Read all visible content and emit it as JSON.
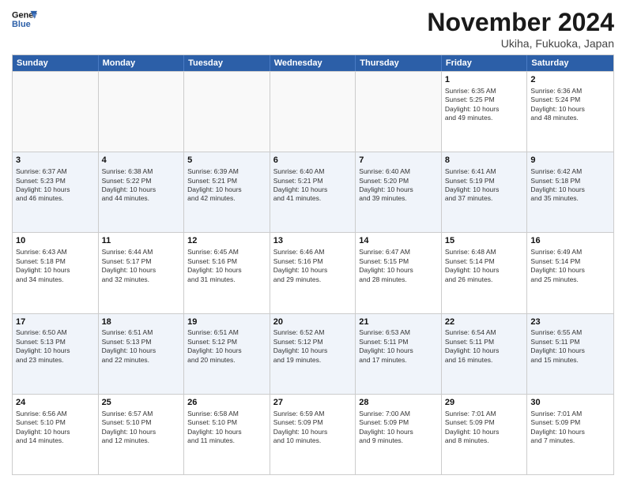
{
  "logo": {
    "line1": "General",
    "line2": "Blue"
  },
  "title": "November 2024",
  "subtitle": "Ukiha, Fukuoka, Japan",
  "header_days": [
    "Sunday",
    "Monday",
    "Tuesday",
    "Wednesday",
    "Thursday",
    "Friday",
    "Saturday"
  ],
  "rows": [
    [
      {
        "day": "",
        "lines": [],
        "empty": true
      },
      {
        "day": "",
        "lines": [],
        "empty": true
      },
      {
        "day": "",
        "lines": [],
        "empty": true
      },
      {
        "day": "",
        "lines": [],
        "empty": true
      },
      {
        "day": "",
        "lines": [],
        "empty": true
      },
      {
        "day": "1",
        "lines": [
          "Sunrise: 6:35 AM",
          "Sunset: 5:25 PM",
          "Daylight: 10 hours",
          "and 49 minutes."
        ],
        "empty": false
      },
      {
        "day": "2",
        "lines": [
          "Sunrise: 6:36 AM",
          "Sunset: 5:24 PM",
          "Daylight: 10 hours",
          "and 48 minutes."
        ],
        "empty": false
      }
    ],
    [
      {
        "day": "3",
        "lines": [
          "Sunrise: 6:37 AM",
          "Sunset: 5:23 PM",
          "Daylight: 10 hours",
          "and 46 minutes."
        ],
        "empty": false
      },
      {
        "day": "4",
        "lines": [
          "Sunrise: 6:38 AM",
          "Sunset: 5:22 PM",
          "Daylight: 10 hours",
          "and 44 minutes."
        ],
        "empty": false
      },
      {
        "day": "5",
        "lines": [
          "Sunrise: 6:39 AM",
          "Sunset: 5:21 PM",
          "Daylight: 10 hours",
          "and 42 minutes."
        ],
        "empty": false
      },
      {
        "day": "6",
        "lines": [
          "Sunrise: 6:40 AM",
          "Sunset: 5:21 PM",
          "Daylight: 10 hours",
          "and 41 minutes."
        ],
        "empty": false
      },
      {
        "day": "7",
        "lines": [
          "Sunrise: 6:40 AM",
          "Sunset: 5:20 PM",
          "Daylight: 10 hours",
          "and 39 minutes."
        ],
        "empty": false
      },
      {
        "day": "8",
        "lines": [
          "Sunrise: 6:41 AM",
          "Sunset: 5:19 PM",
          "Daylight: 10 hours",
          "and 37 minutes."
        ],
        "empty": false
      },
      {
        "day": "9",
        "lines": [
          "Sunrise: 6:42 AM",
          "Sunset: 5:18 PM",
          "Daylight: 10 hours",
          "and 35 minutes."
        ],
        "empty": false
      }
    ],
    [
      {
        "day": "10",
        "lines": [
          "Sunrise: 6:43 AM",
          "Sunset: 5:18 PM",
          "Daylight: 10 hours",
          "and 34 minutes."
        ],
        "empty": false
      },
      {
        "day": "11",
        "lines": [
          "Sunrise: 6:44 AM",
          "Sunset: 5:17 PM",
          "Daylight: 10 hours",
          "and 32 minutes."
        ],
        "empty": false
      },
      {
        "day": "12",
        "lines": [
          "Sunrise: 6:45 AM",
          "Sunset: 5:16 PM",
          "Daylight: 10 hours",
          "and 31 minutes."
        ],
        "empty": false
      },
      {
        "day": "13",
        "lines": [
          "Sunrise: 6:46 AM",
          "Sunset: 5:16 PM",
          "Daylight: 10 hours",
          "and 29 minutes."
        ],
        "empty": false
      },
      {
        "day": "14",
        "lines": [
          "Sunrise: 6:47 AM",
          "Sunset: 5:15 PM",
          "Daylight: 10 hours",
          "and 28 minutes."
        ],
        "empty": false
      },
      {
        "day": "15",
        "lines": [
          "Sunrise: 6:48 AM",
          "Sunset: 5:14 PM",
          "Daylight: 10 hours",
          "and 26 minutes."
        ],
        "empty": false
      },
      {
        "day": "16",
        "lines": [
          "Sunrise: 6:49 AM",
          "Sunset: 5:14 PM",
          "Daylight: 10 hours",
          "and 25 minutes."
        ],
        "empty": false
      }
    ],
    [
      {
        "day": "17",
        "lines": [
          "Sunrise: 6:50 AM",
          "Sunset: 5:13 PM",
          "Daylight: 10 hours",
          "and 23 minutes."
        ],
        "empty": false
      },
      {
        "day": "18",
        "lines": [
          "Sunrise: 6:51 AM",
          "Sunset: 5:13 PM",
          "Daylight: 10 hours",
          "and 22 minutes."
        ],
        "empty": false
      },
      {
        "day": "19",
        "lines": [
          "Sunrise: 6:51 AM",
          "Sunset: 5:12 PM",
          "Daylight: 10 hours",
          "and 20 minutes."
        ],
        "empty": false
      },
      {
        "day": "20",
        "lines": [
          "Sunrise: 6:52 AM",
          "Sunset: 5:12 PM",
          "Daylight: 10 hours",
          "and 19 minutes."
        ],
        "empty": false
      },
      {
        "day": "21",
        "lines": [
          "Sunrise: 6:53 AM",
          "Sunset: 5:11 PM",
          "Daylight: 10 hours",
          "and 17 minutes."
        ],
        "empty": false
      },
      {
        "day": "22",
        "lines": [
          "Sunrise: 6:54 AM",
          "Sunset: 5:11 PM",
          "Daylight: 10 hours",
          "and 16 minutes."
        ],
        "empty": false
      },
      {
        "day": "23",
        "lines": [
          "Sunrise: 6:55 AM",
          "Sunset: 5:11 PM",
          "Daylight: 10 hours",
          "and 15 minutes."
        ],
        "empty": false
      }
    ],
    [
      {
        "day": "24",
        "lines": [
          "Sunrise: 6:56 AM",
          "Sunset: 5:10 PM",
          "Daylight: 10 hours",
          "and 14 minutes."
        ],
        "empty": false
      },
      {
        "day": "25",
        "lines": [
          "Sunrise: 6:57 AM",
          "Sunset: 5:10 PM",
          "Daylight: 10 hours",
          "and 12 minutes."
        ],
        "empty": false
      },
      {
        "day": "26",
        "lines": [
          "Sunrise: 6:58 AM",
          "Sunset: 5:10 PM",
          "Daylight: 10 hours",
          "and 11 minutes."
        ],
        "empty": false
      },
      {
        "day": "27",
        "lines": [
          "Sunrise: 6:59 AM",
          "Sunset: 5:09 PM",
          "Daylight: 10 hours",
          "and 10 minutes."
        ],
        "empty": false
      },
      {
        "day": "28",
        "lines": [
          "Sunrise: 7:00 AM",
          "Sunset: 5:09 PM",
          "Daylight: 10 hours",
          "and 9 minutes."
        ],
        "empty": false
      },
      {
        "day": "29",
        "lines": [
          "Sunrise: 7:01 AM",
          "Sunset: 5:09 PM",
          "Daylight: 10 hours",
          "and 8 minutes."
        ],
        "empty": false
      },
      {
        "day": "30",
        "lines": [
          "Sunrise: 7:01 AM",
          "Sunset: 5:09 PM",
          "Daylight: 10 hours",
          "and 7 minutes."
        ],
        "empty": false
      }
    ]
  ]
}
